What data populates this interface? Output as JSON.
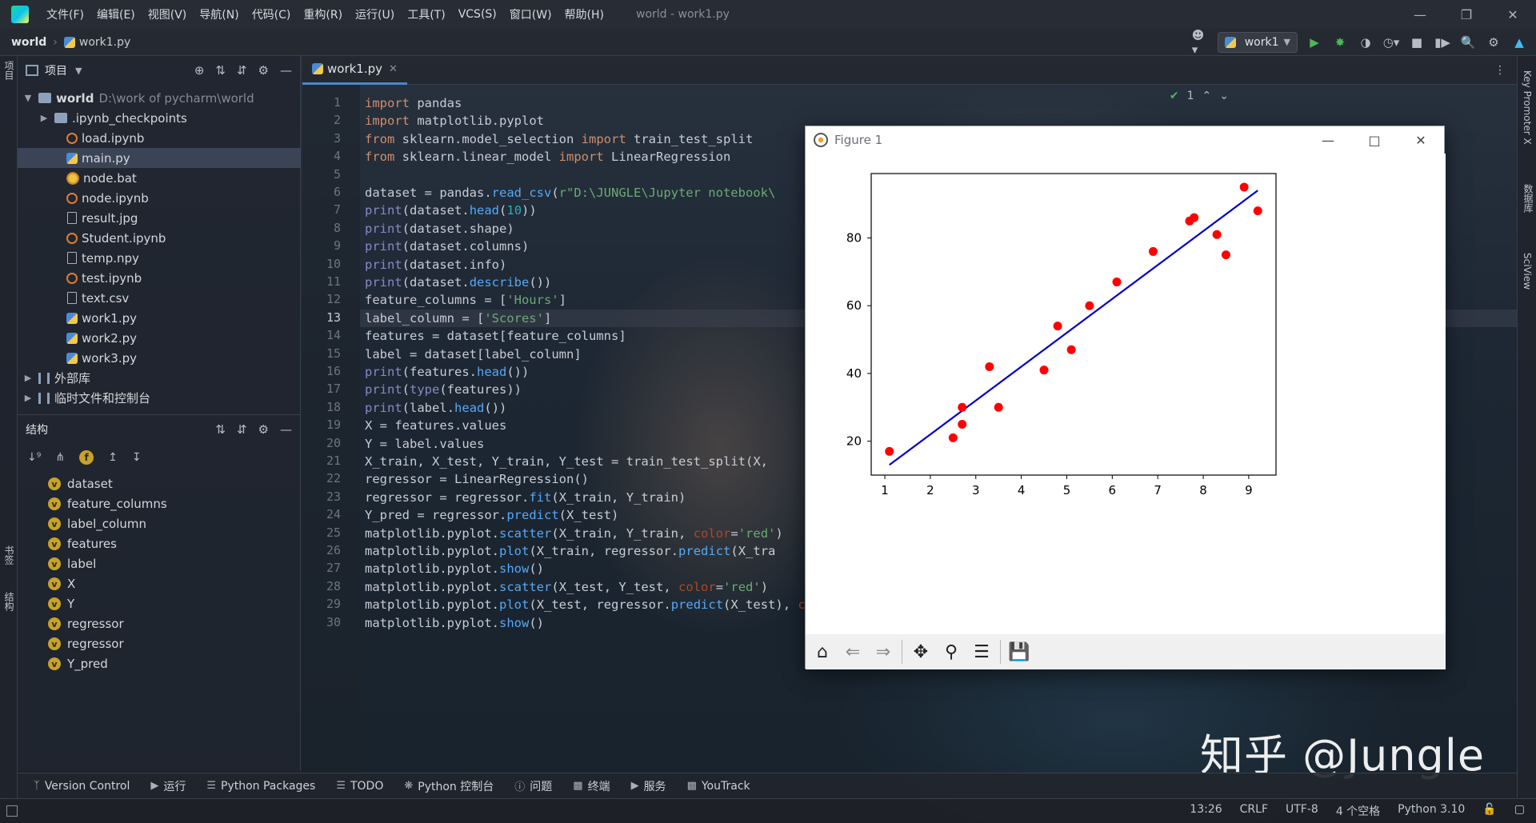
{
  "menubar": {
    "items": [
      "文件(F)",
      "编辑(E)",
      "视图(V)",
      "导航(N)",
      "代码(C)",
      "重构(R)",
      "运行(U)",
      "工具(T)",
      "VCS(S)",
      "窗口(W)",
      "帮助(H)"
    ],
    "window_title": "world - work1.py"
  },
  "navbar": {
    "project": "world",
    "file": "work1.py",
    "run_config": "work1"
  },
  "project_panel": {
    "title": "项目",
    "root": {
      "name": "world",
      "path": "D:\\work of pycharm\\world"
    },
    "items": [
      {
        "name": ".ipynb_checkpoints",
        "kind": "folder"
      },
      {
        "name": "load.ipynb",
        "kind": "notebook"
      },
      {
        "name": "main.py",
        "kind": "python",
        "selected": true
      },
      {
        "name": "node.bat",
        "kind": "bat"
      },
      {
        "name": "node.ipynb",
        "kind": "notebook"
      },
      {
        "name": "result.jpg",
        "kind": "plain"
      },
      {
        "name": "Student.ipynb",
        "kind": "notebook"
      },
      {
        "name": "temp.npy",
        "kind": "plain"
      },
      {
        "name": "test.ipynb",
        "kind": "notebook"
      },
      {
        "name": "text.csv",
        "kind": "plain"
      },
      {
        "name": "work1.py",
        "kind": "python"
      },
      {
        "name": "work2.py",
        "kind": "python"
      },
      {
        "name": "work3.py",
        "kind": "python"
      }
    ],
    "external_libs": "外部库",
    "scratches": "临时文件和控制台"
  },
  "structure_panel": {
    "title": "结构",
    "items": [
      "dataset",
      "feature_columns",
      "label_column",
      "features",
      "label",
      "X",
      "Y",
      "regressor",
      "regressor",
      "Y_pred"
    ]
  },
  "left_strip": {
    "top_label": "项目",
    "bookmarks": "书签",
    "structure": "结构"
  },
  "right_strip": {
    "key_promoter": "Key Promoter X",
    "database": "数据库",
    "sciview": "SciView"
  },
  "editor": {
    "tab": "work1.py",
    "inspection_count": "1",
    "current_line": 13,
    "lines": [
      "import pandas",
      "import matplotlib.pyplot",
      "from sklearn.model_selection import train_test_split",
      "from sklearn.linear_model import LinearRegression",
      "",
      "dataset = pandas.read_csv(r\"D:\\JUNGLE\\Jupyter notebook\\",
      "print(dataset.head(10))",
      "print(dataset.shape)",
      "print(dataset.columns)",
      "print(dataset.info)",
      "print(dataset.describe())",
      "feature_columns = ['Hours']",
      "label_column = ['Scores']",
      "features = dataset[feature_columns]",
      "label = dataset[label_column]",
      "print(features.head())",
      "print(type(features))",
      "print(label.head())",
      "X = features.values",
      "Y = label.values",
      "X_train, X_test, Y_train, Y_test = train_test_split(X,",
      "regressor = LinearRegression()",
      "regressor = regressor.fit(X_train, Y_train)",
      "Y_pred = regressor.predict(X_test)",
      "matplotlib.pyplot.scatter(X_train, Y_train, color='red')",
      "matplotlib.pyplot.plot(X_train, regressor.predict(X_tra",
      "matplotlib.pyplot.show()",
      "matplotlib.pyplot.scatter(X_test, Y_test, color='red')",
      "matplotlib.pyplot.plot(X_test, regressor.predict(X_test), color='blue')",
      "matplotlib.pyplot.show()"
    ]
  },
  "figure": {
    "title": "Figure 1"
  },
  "chart_data": {
    "type": "scatter",
    "x": [
      1.1,
      2.5,
      2.7,
      2.7,
      3.3,
      3.5,
      4.5,
      4.8,
      5.1,
      5.5,
      6.1,
      6.9,
      7.7,
      7.8,
      8.3,
      8.5,
      8.9,
      9.2
    ],
    "y": [
      17,
      21,
      25,
      30,
      42,
      30,
      41,
      54,
      47,
      60,
      67,
      76,
      85,
      86,
      81,
      75,
      95,
      88
    ],
    "point_color": "#ff0000",
    "line": {
      "x": [
        1.1,
        9.2
      ],
      "y": [
        13,
        94
      ],
      "color": "#0000cc"
    },
    "xticks": [
      1,
      2,
      3,
      4,
      5,
      6,
      7,
      8,
      9
    ],
    "yticks": [
      20,
      40,
      60,
      80
    ],
    "xlim": [
      0.7,
      9.6
    ],
    "ylim": [
      10,
      99
    ],
    "grid": false
  },
  "bottom_bar": {
    "items": [
      "Version Control",
      "运行",
      "Python Packages",
      "TODO",
      "Python 控制台",
      "问题",
      "终端",
      "服务",
      "YouTrack"
    ]
  },
  "status_bar": {
    "position": "13:26",
    "line_sep": "CRLF",
    "encoding": "UTF-8",
    "indent": "4 个空格",
    "interpreter": "Python 3.10"
  },
  "watermark": "知乎 @Jungle"
}
